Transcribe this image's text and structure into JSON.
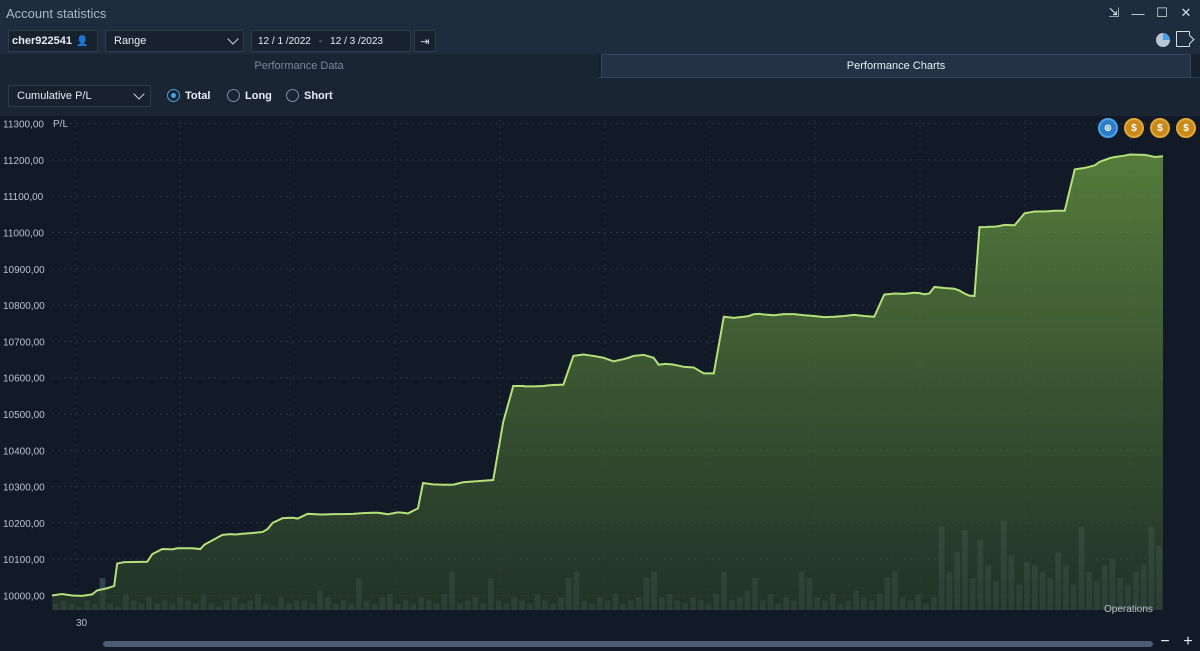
{
  "window": {
    "title": "Account statistics"
  },
  "toolbar": {
    "account": "cher922541",
    "range_value": "Range",
    "date_from": "12 / 1 /2022",
    "date_sep": "-",
    "date_to": "12 / 3 /2023"
  },
  "tabs": [
    {
      "label": "Performance Data",
      "active": false
    },
    {
      "label": "Performance Charts",
      "active": true
    }
  ],
  "options": {
    "metric": "Cumulative P/L",
    "radios": [
      {
        "label": "Total",
        "checked": true
      },
      {
        "label": "Long",
        "checked": false
      },
      {
        "label": "Short",
        "checked": false
      }
    ]
  },
  "chart_buttons": [
    "globe-icon",
    "coin-icon",
    "coin-icon",
    "coin-icon"
  ],
  "colors": {
    "line": "#b5e07a",
    "fill": "#5d8a3a",
    "bars": "#3a4a5c",
    "background": "#111a26"
  },
  "chart_data": {
    "type": "area",
    "ylabel": "P/L",
    "yticks": [
      10000,
      10100,
      10200,
      10300,
      10400,
      10500,
      10600,
      10700,
      10800,
      10900,
      11000,
      11100,
      11200,
      11300
    ],
    "ytick_labels": [
      "10000,00",
      "10100,00",
      "10200,00",
      "10300,00",
      "10400,00",
      "10500,00",
      "10600,00",
      "10700,00",
      "10800,00",
      "10900,00",
      "11000,00",
      "11100,00",
      "11200,00",
      "11300,00"
    ],
    "ylim": [
      9960,
      11310
    ],
    "xtick_label": "30",
    "bar_series_label": "Operations",
    "x": [
      0,
      10,
      20,
      30,
      40,
      45,
      55,
      62,
      65,
      72,
      75,
      95,
      100,
      110,
      120,
      125,
      140,
      148,
      152,
      170,
      178,
      183,
      190,
      200,
      210,
      215,
      220,
      230,
      240,
      245,
      255,
      268,
      270,
      282,
      290,
      300,
      310,
      320,
      325,
      335,
      345,
      350,
      355,
      365,
      370,
      380,
      390,
      400,
      410,
      420,
      430,
      440,
      450,
      460,
      465,
      470,
      472,
      480,
      490,
      495,
      500,
      510,
      520,
      530,
      540,
      550,
      555,
      560,
      565,
      570,
      575,
      580,
      590,
      600,
      605,
      612,
      620,
      630,
      640,
      645,
      650,
      660,
      670,
      680,
      690,
      695,
      700,
      705,
      710,
      720,
      730,
      740,
      750,
      760,
      770,
      780,
      790,
      800,
      810,
      820,
      830,
      840,
      850,
      860,
      865,
      870,
      875,
      880,
      890,
      900,
      905,
      910,
      915,
      920,
      925,
      930,
      935,
      940,
      945,
      950,
      960,
      970,
      980,
      990,
      1000,
      1010,
      1020,
      1030,
      1040,
      1045,
      1050,
      1055,
      1060,
      1070,
      1075,
      1090,
      1100,
      1108
    ],
    "y": [
      10000,
      10004,
      10000,
      9999,
      10003,
      10014,
      10020,
      10026,
      10088,
      10092,
      10092,
      10093,
      10114,
      10128,
      10127,
      10130,
      10130,
      10128,
      10140,
      10167,
      10169,
      10168,
      10170,
      10172,
      10175,
      10183,
      10200,
      10213,
      10214,
      10212,
      10225,
      10223,
      10223,
      10224,
      10224,
      10225,
      10227,
      10228,
      10228,
      10224,
      10229,
      10228,
      10226,
      10240,
      10310,
      10306,
      10305,
      10305,
      10312,
      10314,
      10316,
      10318,
      10478,
      10577,
      10577,
      10577,
      10576,
      10576,
      10577,
      10579,
      10580,
      10581,
      10660,
      10664,
      10660,
      10655,
      10650,
      10645,
      10648,
      10651,
      10655,
      10660,
      10663,
      10655,
      10636,
      10638,
      10636,
      10630,
      10628,
      10620,
      10612,
      10612,
      10768,
      10765,
      10768,
      10770,
      10775,
      10776,
      10774,
      10772,
      10775,
      10775,
      10772,
      10770,
      10767,
      10768,
      10770,
      10773,
      10770,
      10768,
      10829,
      10832,
      10831,
      10834,
      10833,
      10830,
      10832,
      10850,
      10847,
      10845,
      10840,
      10832,
      10826,
      10825,
      11015,
      11015,
      11016,
      11016,
      11018,
      11021,
      11020,
      11053,
      11058,
      11058,
      11060,
      11060,
      11174,
      11178,
      11185,
      11195,
      11200,
      11205,
      11208,
      11212,
      11215,
      11214,
      11208,
      11210,
      11212,
      11218,
      11222,
      11318,
      11298,
      11294,
      11300,
      11298,
      11297,
      11305
    ],
    "bars": {
      "note": "operation count per period",
      "values": [
        2,
        3,
        2,
        1,
        3,
        2,
        10,
        2,
        1,
        5,
        3,
        2,
        4,
        2,
        3,
        2,
        4,
        3,
        2,
        5,
        2,
        1,
        3,
        4,
        2,
        3,
        5,
        2,
        1,
        4,
        2,
        3,
        3,
        2,
        6,
        4,
        2,
        3,
        2,
        10,
        3,
        2,
        4,
        5,
        2,
        3,
        2,
        4,
        3,
        2,
        5,
        12,
        2,
        3,
        4,
        2,
        10,
        3,
        2,
        4,
        3,
        2,
        5,
        3,
        2,
        4,
        10,
        12,
        3,
        2,
        4,
        3,
        5,
        2,
        3,
        4,
        10,
        12,
        4,
        5,
        3,
        2,
        4,
        3,
        2,
        5,
        12,
        3,
        4,
        6,
        10,
        3,
        5,
        2,
        4,
        3,
        12,
        10,
        4,
        3,
        5,
        2,
        3,
        6,
        4,
        3,
        5,
        10,
        12,
        4,
        3,
        5,
        2,
        4,
        26,
        12,
        18,
        25,
        10,
        22,
        14,
        9,
        28,
        17,
        8,
        15,
        14,
        12,
        10,
        18,
        14,
        8,
        26,
        12,
        9,
        14,
        16,
        10,
        8,
        12,
        14,
        26,
        20
      ]
    }
  }
}
